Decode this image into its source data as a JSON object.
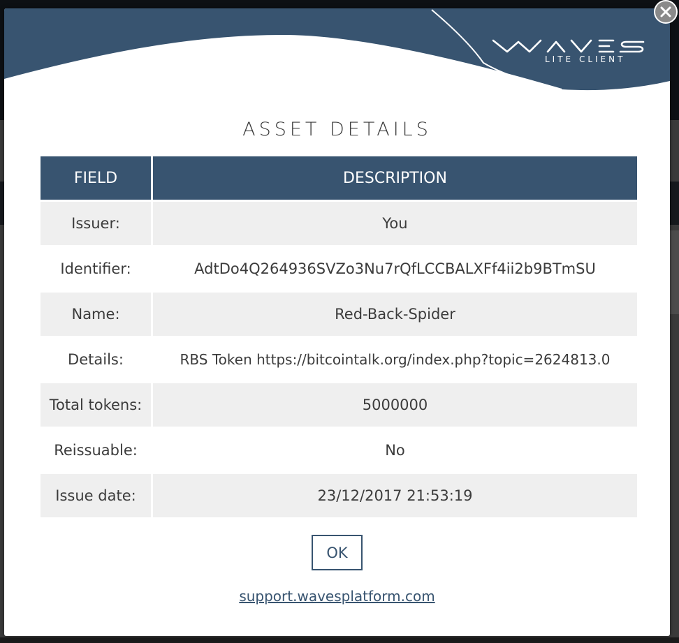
{
  "brand": {
    "subtitle": "LITE CLIENT",
    "colors": {
      "header": "#385470",
      "accent": "#385470"
    }
  },
  "modal": {
    "title": "ASSET DETAILS",
    "table": {
      "headers": [
        "FIELD",
        "DESCRIPTION"
      ],
      "rows": [
        {
          "field": "Issuer:",
          "value": "You"
        },
        {
          "field": "Identifier:",
          "value": "AdtDo4Q264936SVZo3Nu7rQfLCCBALXFf4ii2b9BTmSU"
        },
        {
          "field": "Name:",
          "value": "Red-Back-Spider"
        },
        {
          "field": "Details:",
          "value": "RBS Token https://bitcointalk.org/index.php?topic=2624813.0"
        },
        {
          "field": "Total tokens:",
          "value": "5000000"
        },
        {
          "field": "Reissuable:",
          "value": "No"
        },
        {
          "field": "Issue date:",
          "value": "23/12/2017 21:53:19"
        }
      ]
    },
    "ok_label": "OK",
    "support_link": "support.wavesplatform.com",
    "close_icon": "close-icon"
  }
}
